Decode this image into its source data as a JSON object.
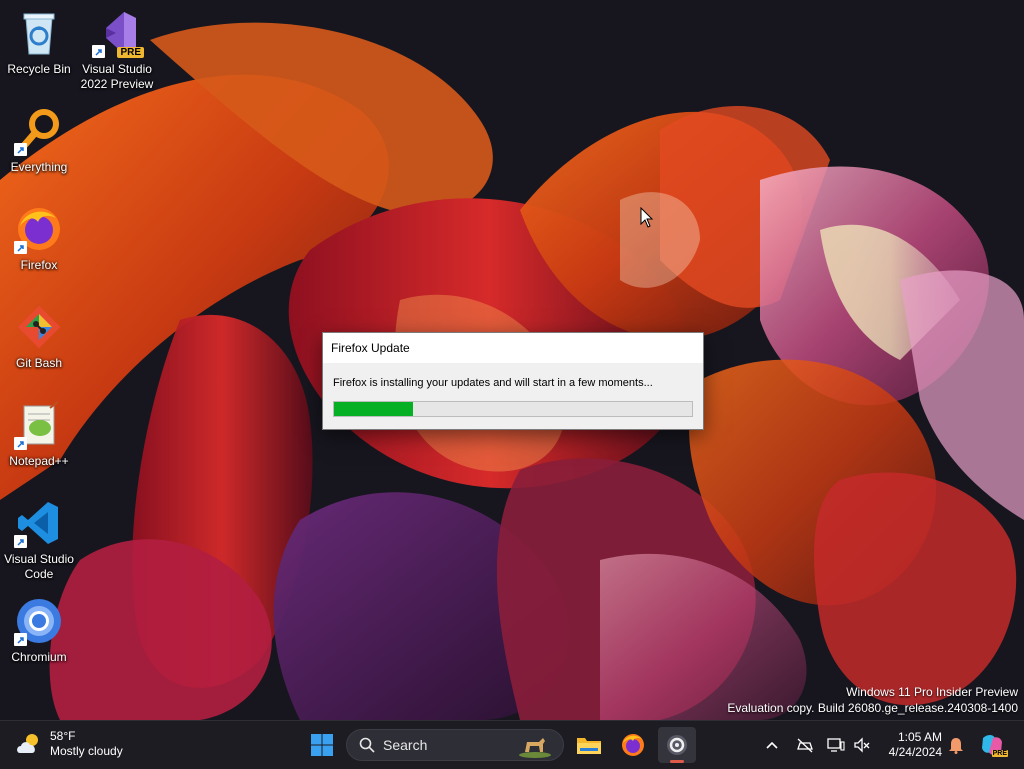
{
  "desktop": {
    "icons": [
      {
        "label": "Recycle Bin",
        "icon": "recycle-bin-icon"
      },
      {
        "label": "Visual Studio\n2022 Preview",
        "icon": "visual-studio-icon",
        "badge": "PRE"
      },
      {
        "label": "Everything",
        "icon": "everything-search-icon"
      },
      {
        "label": "Firefox",
        "icon": "firefox-icon"
      },
      {
        "label": "Git Bash",
        "icon": "git-bash-icon"
      },
      {
        "label": "Notepad++",
        "icon": "notepad-plus-plus-icon"
      },
      {
        "label": "Visual Studio\nCode",
        "icon": "vscode-icon"
      },
      {
        "label": "Chromium",
        "icon": "chromium-icon"
      }
    ],
    "watermark": {
      "line1": "Windows 11 Pro Insider Preview",
      "line2": "Evaluation copy. Build 26080.ge_release.240308-1400"
    }
  },
  "dialog": {
    "title": "Firefox Update",
    "message": "Firefox is installing your updates and will start in a few moments...",
    "progress": 0.22,
    "progress_color": "#06b025"
  },
  "taskbar": {
    "weather": {
      "temp": "58°F",
      "condition": "Mostly cloudy",
      "icon": "cloud-sun-icon"
    },
    "search": {
      "placeholder": "Search"
    },
    "apps": [
      {
        "name": "file-explorer",
        "icon": "folder-icon",
        "active": false
      },
      {
        "name": "firefox",
        "icon": "firefox-icon",
        "active": false
      },
      {
        "name": "firefox-updater",
        "icon": "updater-icon",
        "active": true
      }
    ],
    "tray": {
      "icons": [
        "chevron-up-icon",
        "network-off-icon",
        "display-icon",
        "volume-muted-icon"
      ],
      "clock_time": "1:05 AM",
      "clock_date": "4/24/2024",
      "notification_icon": "bell-icon",
      "copilot_badge": "PRE"
    }
  }
}
